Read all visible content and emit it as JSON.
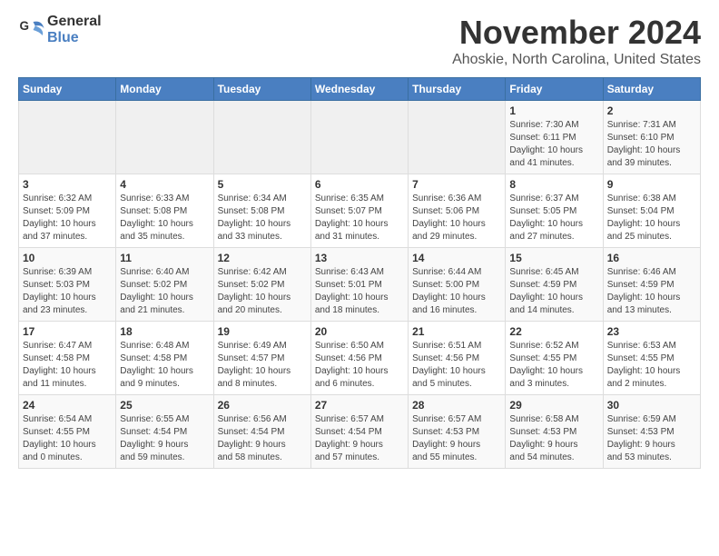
{
  "header": {
    "logo_general": "General",
    "logo_blue": "Blue",
    "month_title": "November 2024",
    "location": "Ahoskie, North Carolina, United States"
  },
  "columns": [
    "Sunday",
    "Monday",
    "Tuesday",
    "Wednesday",
    "Thursday",
    "Friday",
    "Saturday"
  ],
  "weeks": [
    {
      "days": [
        {
          "num": "",
          "info": "",
          "empty": true
        },
        {
          "num": "",
          "info": "",
          "empty": true
        },
        {
          "num": "",
          "info": "",
          "empty": true
        },
        {
          "num": "",
          "info": "",
          "empty": true
        },
        {
          "num": "",
          "info": "",
          "empty": true
        },
        {
          "num": "1",
          "info": "Sunrise: 7:30 AM\nSunset: 6:11 PM\nDaylight: 10 hours\nand 41 minutes.",
          "empty": false
        },
        {
          "num": "2",
          "info": "Sunrise: 7:31 AM\nSunset: 6:10 PM\nDaylight: 10 hours\nand 39 minutes.",
          "empty": false
        }
      ]
    },
    {
      "days": [
        {
          "num": "3",
          "info": "Sunrise: 6:32 AM\nSunset: 5:09 PM\nDaylight: 10 hours\nand 37 minutes.",
          "empty": false
        },
        {
          "num": "4",
          "info": "Sunrise: 6:33 AM\nSunset: 5:08 PM\nDaylight: 10 hours\nand 35 minutes.",
          "empty": false
        },
        {
          "num": "5",
          "info": "Sunrise: 6:34 AM\nSunset: 5:08 PM\nDaylight: 10 hours\nand 33 minutes.",
          "empty": false
        },
        {
          "num": "6",
          "info": "Sunrise: 6:35 AM\nSunset: 5:07 PM\nDaylight: 10 hours\nand 31 minutes.",
          "empty": false
        },
        {
          "num": "7",
          "info": "Sunrise: 6:36 AM\nSunset: 5:06 PM\nDaylight: 10 hours\nand 29 minutes.",
          "empty": false
        },
        {
          "num": "8",
          "info": "Sunrise: 6:37 AM\nSunset: 5:05 PM\nDaylight: 10 hours\nand 27 minutes.",
          "empty": false
        },
        {
          "num": "9",
          "info": "Sunrise: 6:38 AM\nSunset: 5:04 PM\nDaylight: 10 hours\nand 25 minutes.",
          "empty": false
        }
      ]
    },
    {
      "days": [
        {
          "num": "10",
          "info": "Sunrise: 6:39 AM\nSunset: 5:03 PM\nDaylight: 10 hours\nand 23 minutes.",
          "empty": false
        },
        {
          "num": "11",
          "info": "Sunrise: 6:40 AM\nSunset: 5:02 PM\nDaylight: 10 hours\nand 21 minutes.",
          "empty": false
        },
        {
          "num": "12",
          "info": "Sunrise: 6:42 AM\nSunset: 5:02 PM\nDaylight: 10 hours\nand 20 minutes.",
          "empty": false
        },
        {
          "num": "13",
          "info": "Sunrise: 6:43 AM\nSunset: 5:01 PM\nDaylight: 10 hours\nand 18 minutes.",
          "empty": false
        },
        {
          "num": "14",
          "info": "Sunrise: 6:44 AM\nSunset: 5:00 PM\nDaylight: 10 hours\nand 16 minutes.",
          "empty": false
        },
        {
          "num": "15",
          "info": "Sunrise: 6:45 AM\nSunset: 4:59 PM\nDaylight: 10 hours\nand 14 minutes.",
          "empty": false
        },
        {
          "num": "16",
          "info": "Sunrise: 6:46 AM\nSunset: 4:59 PM\nDaylight: 10 hours\nand 13 minutes.",
          "empty": false
        }
      ]
    },
    {
      "days": [
        {
          "num": "17",
          "info": "Sunrise: 6:47 AM\nSunset: 4:58 PM\nDaylight: 10 hours\nand 11 minutes.",
          "empty": false
        },
        {
          "num": "18",
          "info": "Sunrise: 6:48 AM\nSunset: 4:58 PM\nDaylight: 10 hours\nand 9 minutes.",
          "empty": false
        },
        {
          "num": "19",
          "info": "Sunrise: 6:49 AM\nSunset: 4:57 PM\nDaylight: 10 hours\nand 8 minutes.",
          "empty": false
        },
        {
          "num": "20",
          "info": "Sunrise: 6:50 AM\nSunset: 4:56 PM\nDaylight: 10 hours\nand 6 minutes.",
          "empty": false
        },
        {
          "num": "21",
          "info": "Sunrise: 6:51 AM\nSunset: 4:56 PM\nDaylight: 10 hours\nand 5 minutes.",
          "empty": false
        },
        {
          "num": "22",
          "info": "Sunrise: 6:52 AM\nSunset: 4:55 PM\nDaylight: 10 hours\nand 3 minutes.",
          "empty": false
        },
        {
          "num": "23",
          "info": "Sunrise: 6:53 AM\nSunset: 4:55 PM\nDaylight: 10 hours\nand 2 minutes.",
          "empty": false
        }
      ]
    },
    {
      "days": [
        {
          "num": "24",
          "info": "Sunrise: 6:54 AM\nSunset: 4:55 PM\nDaylight: 10 hours\nand 0 minutes.",
          "empty": false
        },
        {
          "num": "25",
          "info": "Sunrise: 6:55 AM\nSunset: 4:54 PM\nDaylight: 9 hours\nand 59 minutes.",
          "empty": false
        },
        {
          "num": "26",
          "info": "Sunrise: 6:56 AM\nSunset: 4:54 PM\nDaylight: 9 hours\nand 58 minutes.",
          "empty": false
        },
        {
          "num": "27",
          "info": "Sunrise: 6:57 AM\nSunset: 4:54 PM\nDaylight: 9 hours\nand 57 minutes.",
          "empty": false
        },
        {
          "num": "28",
          "info": "Sunrise: 6:57 AM\nSunset: 4:53 PM\nDaylight: 9 hours\nand 55 minutes.",
          "empty": false
        },
        {
          "num": "29",
          "info": "Sunrise: 6:58 AM\nSunset: 4:53 PM\nDaylight: 9 hours\nand 54 minutes.",
          "empty": false
        },
        {
          "num": "30",
          "info": "Sunrise: 6:59 AM\nSunset: 4:53 PM\nDaylight: 9 hours\nand 53 minutes.",
          "empty": false
        }
      ]
    }
  ]
}
